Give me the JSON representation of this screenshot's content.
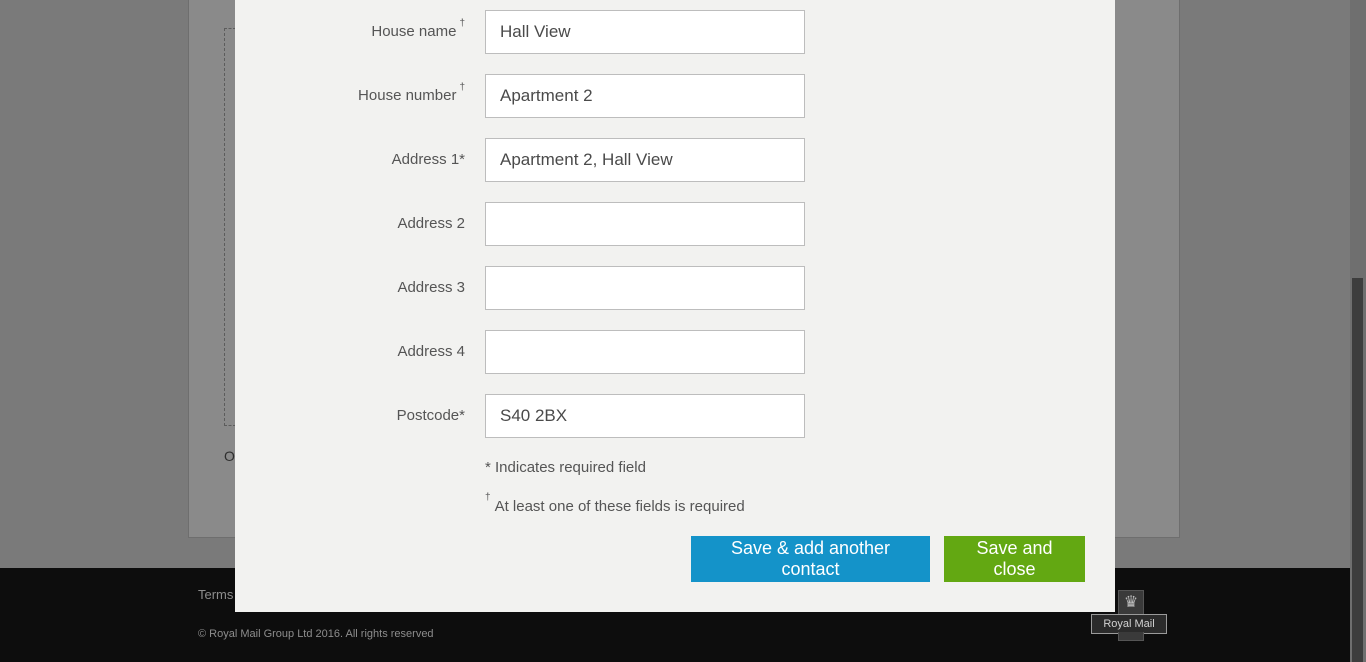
{
  "background": {
    "fragment_text": "Or",
    "footer": {
      "terms_link": "Terms",
      "copyright": "© Royal Mail Group Ltd 2016. All rights reserved",
      "logo_text": "Royal Mail",
      "crown_glyph": "♛"
    }
  },
  "form": {
    "fields": [
      {
        "label": "House name",
        "marker": "†",
        "value": ""
      },
      {
        "label": "House number",
        "marker": "†",
        "value": ""
      },
      {
        "label": "Address 1*",
        "marker": "",
        "value": ""
      },
      {
        "label": "Address 2",
        "marker": "",
        "value": ""
      },
      {
        "label": "Address 3",
        "marker": "",
        "value": ""
      },
      {
        "label": "Address 4",
        "marker": "",
        "value": ""
      },
      {
        "label": "Postcode*",
        "marker": "",
        "value": ""
      }
    ],
    "values": {
      "house_name": "Hall View",
      "house_number": "Apartment 2",
      "address1": "Apartment 2, Hall View",
      "address2": "",
      "address3": "",
      "address4": "",
      "postcode": "S40 2BX"
    },
    "required_note": "* Indicates required field",
    "either_note_marker": "†",
    "either_note": "At least one of these fields is required"
  },
  "buttons": {
    "save_add": "Save & add another contact",
    "save_close": "Save and close"
  },
  "colors": {
    "primary_button": "#1493c9",
    "success_button": "#63a812",
    "modal_bg": "#f2f2f0",
    "overlay": "#7a7a7a"
  }
}
